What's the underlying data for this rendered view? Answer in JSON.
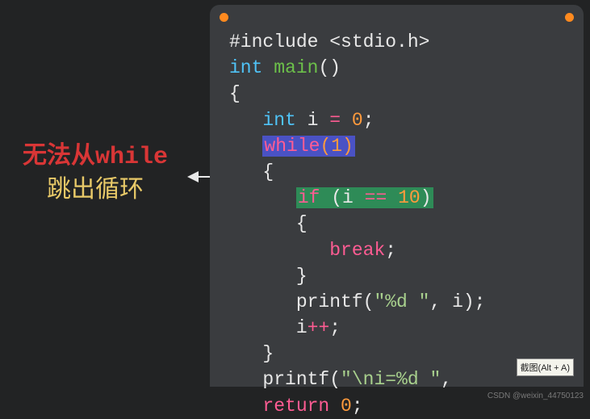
{
  "annotation": {
    "line1": "无法从while",
    "line2": "跳出循环"
  },
  "window": {
    "dot_color": "#ff8a1f"
  },
  "code": {
    "l1_include": "#include <stdio.h>",
    "l2_int": "int",
    "l2_main": " main",
    "l2_paren": "()",
    "l3_brace": "{",
    "l4_int": "int",
    "l4_var": " i ",
    "l4_op": "=",
    "l4_val": " 0",
    "l4_semi": ";",
    "l5_while": "while",
    "l5_arg": "(1)",
    "l6_brace": "{",
    "l7_if": "if",
    "l7_sp": " (i ",
    "l7_op": "==",
    "l7_val": " 10",
    "l7_close": ")",
    "l8_brace": "{",
    "l9_break": "break",
    "l9_semi": ";",
    "l10_brace": "}",
    "l11_printf": "printf(",
    "l11_str": "\"%d \"",
    "l11_rest": ", i);",
    "l12_inc": "i",
    "l12_op": "++",
    "l12_semi": ";",
    "l13_brace": "}",
    "l14_printf": "printf(",
    "l14_str": "\"\\ni=%d \"",
    "l14_rest": ", ",
    "l15_return": "return",
    "l15_val": " 0",
    "l15_semi": ";"
  },
  "tooltip": "截图(Alt + A)",
  "watermark": "CSDN @weixin_44750123"
}
